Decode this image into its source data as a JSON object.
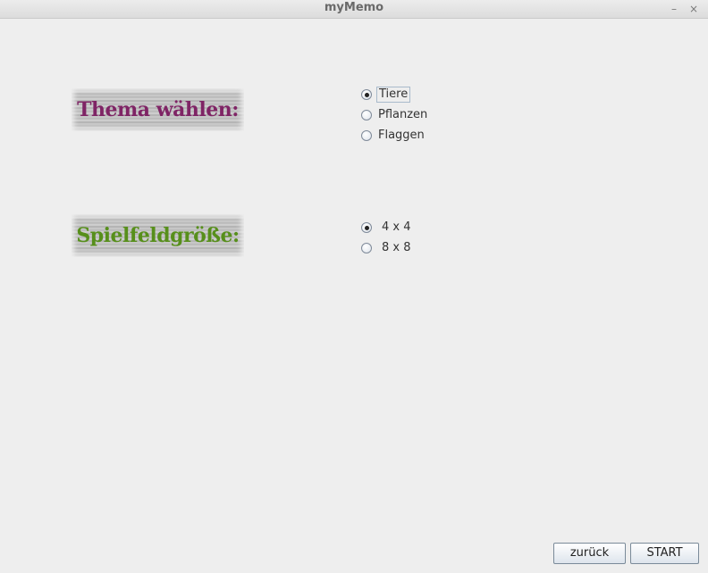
{
  "window": {
    "title": "myMemo",
    "minimize_glyph": "–",
    "close_glyph": "×"
  },
  "theme_section": {
    "heading": "Thema wählen:",
    "options": [
      {
        "label": "Tiere",
        "selected": true
      },
      {
        "label": "Pflanzen",
        "selected": false
      },
      {
        "label": "Flaggen",
        "selected": false
      }
    ]
  },
  "size_section": {
    "heading": "Spielfeldgröße:",
    "options": [
      {
        "label": "4 x 4",
        "selected": true
      },
      {
        "label": "8 x 8",
        "selected": false
      }
    ]
  },
  "buttons": {
    "back_label": "zurück",
    "start_label": "START"
  },
  "colors": {
    "theme_heading": "#7a1a5e",
    "size_heading": "#4f8a10"
  }
}
